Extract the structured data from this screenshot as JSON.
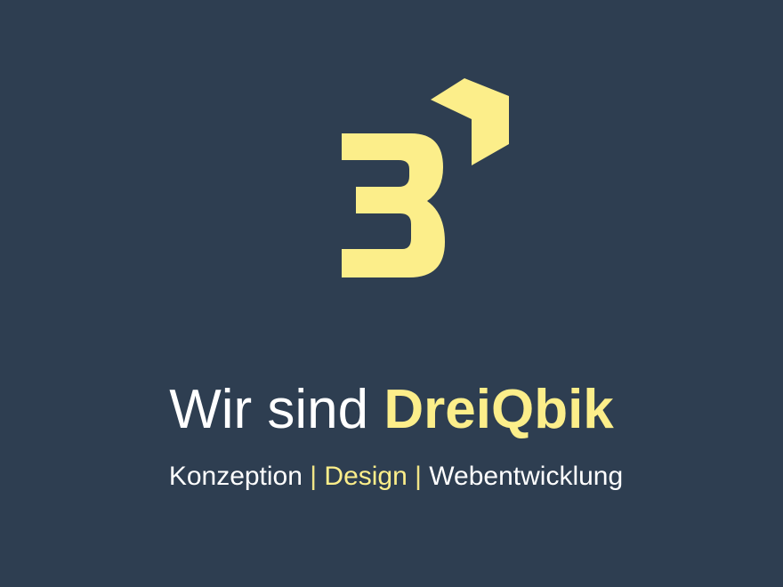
{
  "logo": {
    "name": "dreiqbik-3-cube-logo"
  },
  "headline": {
    "prefix": "Wir sind ",
    "brand": "DreiQbik"
  },
  "tagline": {
    "items": [
      "Konzeption",
      "Design",
      "Webentwicklung"
    ],
    "separator": " | "
  },
  "colors": {
    "background": "#2e3e51",
    "accent": "#fcee8a",
    "text": "#ffffff"
  }
}
